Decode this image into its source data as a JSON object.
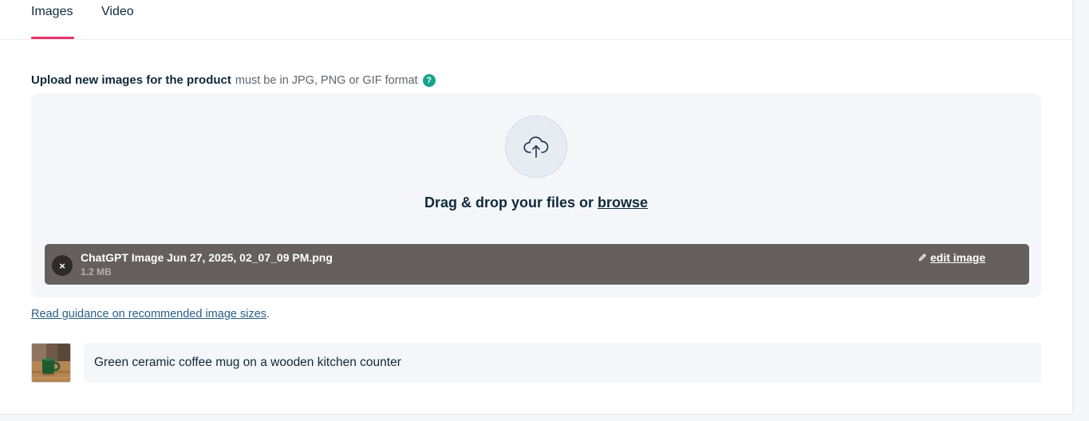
{
  "tabs": [
    {
      "label": "Images",
      "active": true
    },
    {
      "label": "Video",
      "active": false
    }
  ],
  "upload": {
    "heading": "Upload new images for the product",
    "format_note": "must be in JPG, PNG or GIF format",
    "help_icon": "?",
    "drop_text": "Drag & drop your files or",
    "browse_label": "browse",
    "cloud_icon": "cloud-upload-icon"
  },
  "file": {
    "name": "ChatGPT Image Jun 27, 2025, 02_07_09 PM.png",
    "size": "1.2 MB",
    "remove_icon": "×",
    "edit_label": "edit image"
  },
  "guidance": {
    "link_text": "Read guidance on recommended image sizes",
    "suffix": "."
  },
  "alt_text": {
    "value": "Green ceramic coffee mug on a wooden kitchen counter"
  },
  "colors": {
    "accent_underline": "#e6356b",
    "help_green": "#14a38b",
    "file_row_bg": "#65605e",
    "link_blue": "#2a5f86"
  }
}
